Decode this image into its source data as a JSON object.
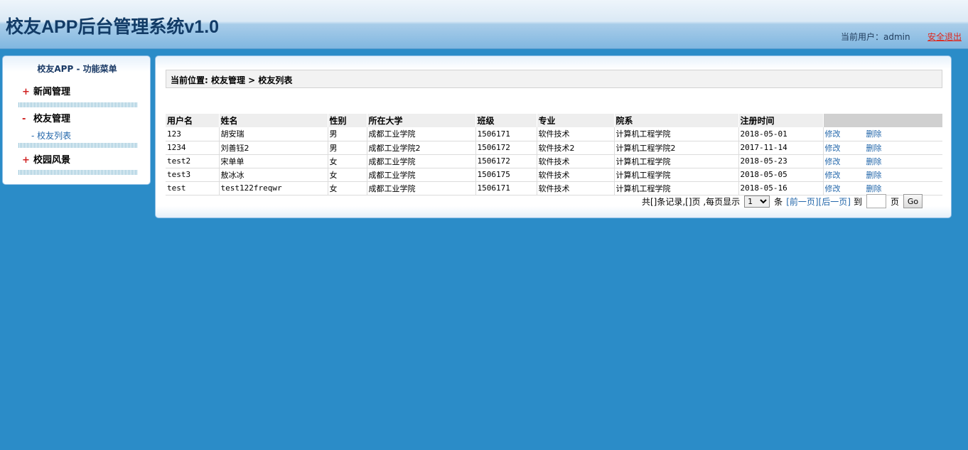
{
  "header": {
    "title": "校友APP后台管理系统v1.0",
    "user_label": "当前用户：admin",
    "logout_label": "安全退出"
  },
  "sidebar": {
    "title": "校友APP - 功能菜单",
    "groups": [
      {
        "sign": "+",
        "label": "新闻管理"
      },
      {
        "sign": "-",
        "label": "校友管理"
      },
      {
        "sign": "+",
        "label": "校园风景"
      }
    ],
    "subitems": [
      {
        "label": "- 校友列表"
      }
    ]
  },
  "main": {
    "breadcrumb": "当前位置: 校友管理 > 校友列表",
    "columns": [
      "用户名",
      "姓名",
      "性别",
      "所在大学",
      "班级",
      "专业",
      "院系",
      "注册时间",
      ""
    ],
    "rows": [
      {
        "username": "123",
        "name": "胡安瑞",
        "gender": "男",
        "university": "成都工业学院",
        "class": "1506171",
        "major": "软件技术",
        "dept": "计算机工程学院",
        "date": "2018-05-01",
        "edit": "修改",
        "delete": "删除"
      },
      {
        "username": "1234",
        "name": "刘善钰2",
        "gender": "男",
        "university": "成都工业学院2",
        "class": "1506172",
        "major": "软件技术2",
        "dept": "计算机工程学院2",
        "date": "2017-11-14",
        "edit": "修改",
        "delete": "删除"
      },
      {
        "username": "test2",
        "name": "宋单单",
        "gender": "女",
        "university": "成都工业学院",
        "class": "1506172",
        "major": "软件技术",
        "dept": "计算机工程学院",
        "date": "2018-05-23",
        "edit": "修改",
        "delete": "删除"
      },
      {
        "username": "test3",
        "name": "敖冰冰",
        "gender": "女",
        "university": "成都工业学院",
        "class": "1506175",
        "major": "软件技术",
        "dept": "计算机工程学院",
        "date": "2018-05-05",
        "edit": "修改",
        "delete": "删除"
      },
      {
        "username": "test",
        "name": "test122freqwr",
        "gender": "女",
        "university": "成都工业学院",
        "class": "1506171",
        "major": "软件技术",
        "dept": "计算机工程学院",
        "date": "2018-05-16",
        "edit": "修改",
        "delete": "删除"
      }
    ],
    "pager": {
      "summary": "共[]条记录,[]页 ,每页显示",
      "page_size": "1",
      "unit": "条",
      "prev": "[前一页]",
      "next": "[后一页]",
      "goto_label": "到",
      "page_label": "页",
      "go_button": "Go"
    }
  }
}
